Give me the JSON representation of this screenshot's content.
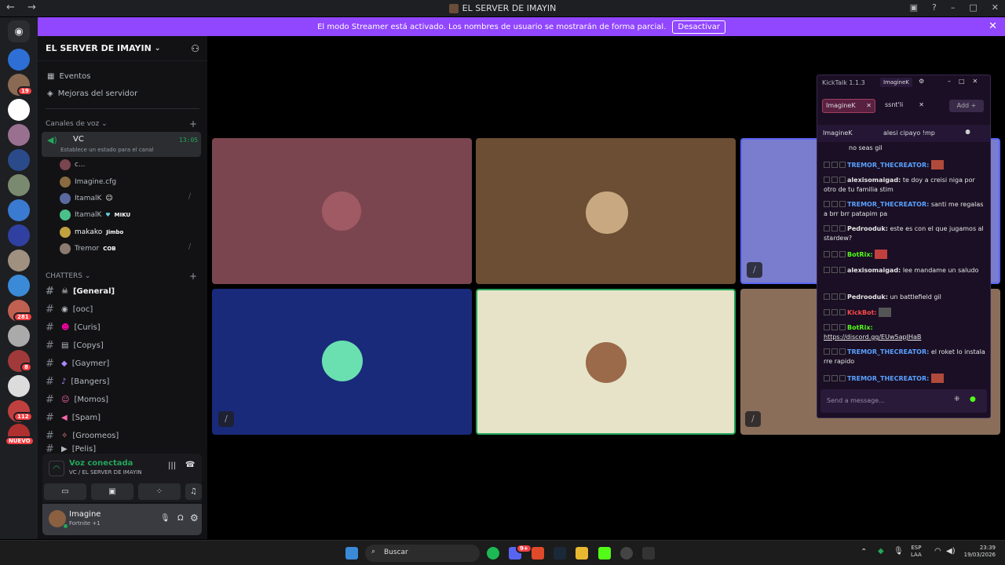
{
  "window": {
    "title": "EL SERVER DE IMAYIN",
    "nav": "← →"
  },
  "banner": {
    "text": "El modo Streamer está activado. Los nombres de usuario se mostrarán de forma parcial.",
    "button": "Desactivar"
  },
  "guild_badges": [
    "19",
    "281",
    "8",
    "112"
  ],
  "guild_new": "NUEVO",
  "server": {
    "name": "EL SERVER DE IMAYIN",
    "events": "Eventos",
    "boosts": "Mejoras del servidor"
  },
  "voice_category": "Canales de voz",
  "voice_channel": {
    "name": "VC",
    "timer": "13:05",
    "status": "Establece un estado para el canal"
  },
  "voice_users": [
    {
      "name": "c...",
      "tag": ""
    },
    {
      "name": "Imagine.cfg",
      "tag": ""
    },
    {
      "name": "ItamalK",
      "tag": ""
    },
    {
      "name": "ItamalK",
      "tag": "MIKU"
    },
    {
      "name": "makako",
      "tag": "Jimbo"
    },
    {
      "name": "Tremor",
      "tag": "COB"
    }
  ],
  "chatters_category": "CHATTERS",
  "channels": [
    "[General]",
    "[ooc]",
    "[Curis]",
    "[Copys]",
    "[Gaymer]",
    "[Bangers]",
    "[Momos]",
    "[Spam]",
    "[Groomeos]",
    "[Pelis]"
  ],
  "voice_panel": {
    "title": "Voz conectada",
    "subtitle": "VC / EL SERVER DE IMAYIN"
  },
  "user_panel": {
    "name": "Imagine",
    "status": "Fortnite +1"
  },
  "colors": {
    "banner": "#9146ff",
    "tile1": "#7a454f",
    "tile2": "#6b4e33",
    "tile3": "#7a7dcd",
    "tile4": "#1a2a7a",
    "tile5": "#e6e3c9",
    "tile6": "#8a6e5a"
  },
  "kick": {
    "app": "KickTalk 1.1.3",
    "user_tab": "ImagineK",
    "chips": [
      "ImagineK",
      "ssnt'li"
    ],
    "add": "Add +",
    "header_user": "ImagineK",
    "header_msg": "alesi cipayo !mp",
    "messages": [
      {
        "user": "",
        "text": "no seas gil"
      },
      {
        "user": "TREMOR_THECREATOR:",
        "text": ""
      },
      {
        "user": "alexisomaigad:",
        "text": "te doy a creisi niga por otro de tu familia stim"
      },
      {
        "user": "TREMOR_THECREATOR:",
        "text": "santi me regalas a brr brr patapim pa"
      },
      {
        "user": "Pedrooduk:",
        "text": "este es con el que jugamos al stardew?"
      },
      {
        "user": "BotRix:",
        "text": ""
      },
      {
        "user": "alexisomaigad:",
        "text": "lee mandame un saludo"
      },
      {
        "user": "Pedrooduk:",
        "text": "un battlefield gil"
      },
      {
        "user": "KickBot:",
        "text": ""
      },
      {
        "user": "BotRix:",
        "text": "https://discord.gg/EUw5apJHaB"
      },
      {
        "user": "TREMOR_THECREATOR:",
        "text": "el roket lo instala rre rapido"
      },
      {
        "user": "TREMOR_THECREATOR:",
        "text": ""
      }
    ],
    "placeholder": "Send a message..."
  },
  "taskbar": {
    "search": "Buscar",
    "lang1": "ESP",
    "lang2": "LAA",
    "time": "23:39",
    "date": "19/03/2026",
    "badge": "9+"
  }
}
